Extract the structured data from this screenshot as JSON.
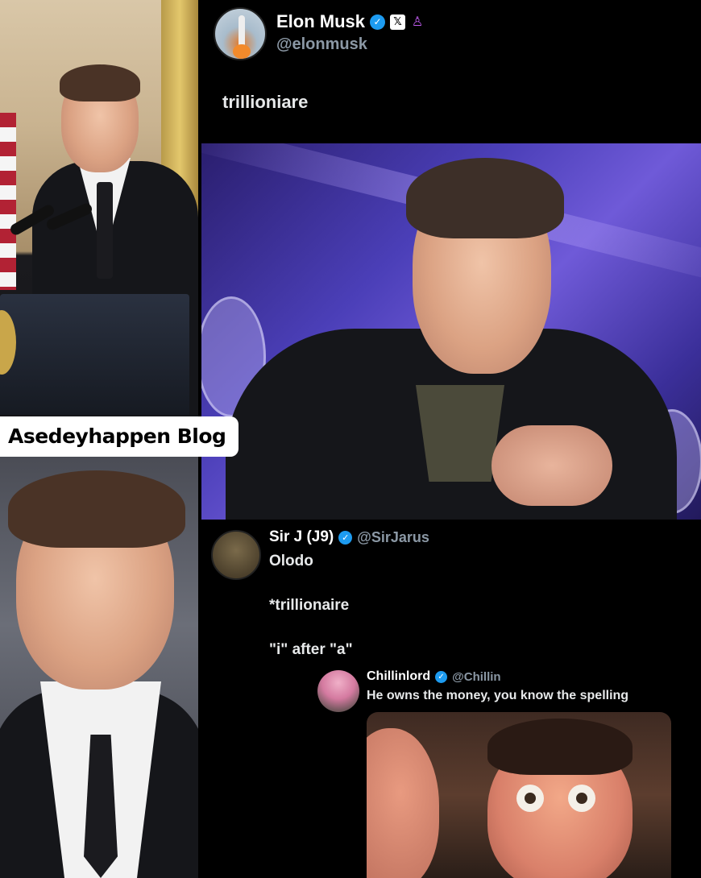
{
  "watermark": {
    "text": "Asedeyhappen Blog"
  },
  "tweet": {
    "author": {
      "display_name": "Elon Musk",
      "handle": "@elonmusk",
      "verified": true,
      "badges": [
        "verified-icon",
        "x-logo-icon",
        "affiliate-icon"
      ]
    },
    "text": "trillioniare"
  },
  "replies": [
    {
      "display_name": "Sir J (J9)",
      "handle": "@SirJarus",
      "verified": true,
      "lines": [
        "Olodo",
        "*trillionaire",
        "\"i\" after \"a\""
      ]
    },
    {
      "display_name": "Chillinlord",
      "handle": "@Chillin",
      "verified": true,
      "text": "He owns the money, you know the spelling"
    }
  ],
  "colors": {
    "background": "#000000",
    "verified": "#1d9bf0",
    "handle": "#8b98a5",
    "text": "#e7e9ea"
  }
}
